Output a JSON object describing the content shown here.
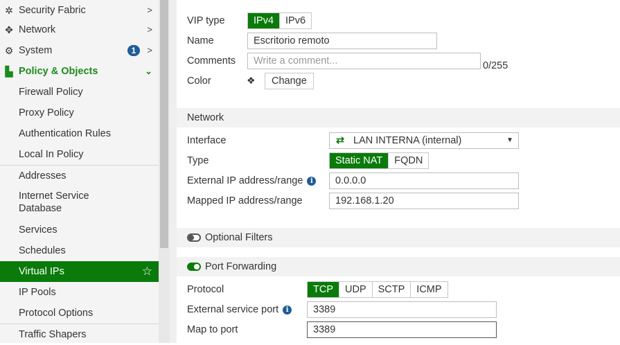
{
  "sidebar": {
    "items": [
      {
        "label": "Security Fabric",
        "icon": "fabric-icon"
      },
      {
        "label": "Network",
        "icon": "network-icon"
      },
      {
        "label": "System",
        "icon": "gear-icon",
        "badge": "1"
      },
      {
        "label": "Policy & Objects",
        "icon": "policy-icon"
      },
      {
        "label": "Firewall Policy"
      },
      {
        "label": "Proxy Policy"
      },
      {
        "label": "Authentication Rules"
      },
      {
        "label": "Local In Policy"
      },
      {
        "label": "Addresses"
      },
      {
        "label": "Internet Service"
      },
      {
        "label": "Database"
      },
      {
        "label": "Services"
      },
      {
        "label": "Schedules"
      },
      {
        "label": "Virtual IPs"
      },
      {
        "label": "IP Pools"
      },
      {
        "label": "Protocol Options"
      },
      {
        "label": "Traffic Shapers"
      }
    ]
  },
  "form": {
    "vip_type_label": "VIP type",
    "vip_type_options": [
      "IPv4",
      "IPv6"
    ],
    "name_label": "Name",
    "name_value": "Escritorio remoto",
    "comments_label": "Comments",
    "comments_placeholder": "Write a comment...",
    "comments_counter": "0/255",
    "color_label": "Color",
    "change_label": "Change"
  },
  "network": {
    "section_title": "Network",
    "interface_label": "Interface",
    "interface_value": "LAN INTERNA (internal)",
    "type_label": "Type",
    "type_options": [
      "Static NAT",
      "FQDN"
    ],
    "external_ip_label": "External IP address/range",
    "external_ip_value": "0.0.0.0",
    "mapped_ip_label": "Mapped IP address/range",
    "mapped_ip_value": "192.168.1.20"
  },
  "optional_filters": {
    "title": "Optional Filters",
    "enabled": false
  },
  "port_forwarding": {
    "title": "Port Forwarding",
    "enabled": true,
    "protocol_label": "Protocol",
    "protocol_options": [
      "TCP",
      "UDP",
      "SCTP",
      "ICMP"
    ],
    "external_port_label": "External service port",
    "external_port_value": "3389",
    "map_port_label": "Map to port",
    "map_port_value": "3389"
  },
  "colors": {
    "accent": "#0a7b0a",
    "badge": "#1f5c99"
  }
}
